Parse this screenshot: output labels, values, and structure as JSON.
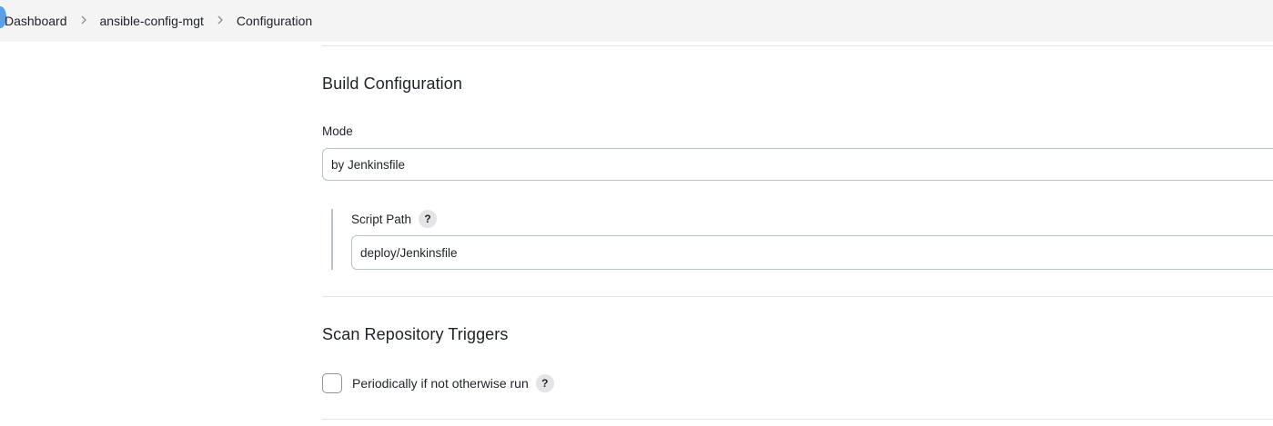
{
  "breadcrumb": {
    "items": [
      "Dashboard",
      "ansible-config-mgt",
      "Configuration"
    ],
    "separator": ">"
  },
  "build_configuration": {
    "title": "Build Configuration",
    "mode_label": "Mode",
    "mode_value": "by Jenkinsfile",
    "script_path_label": "Script Path",
    "script_path_value": "deploy/Jenkinsfile",
    "help_glyph": "?"
  },
  "scan_triggers": {
    "title": "Scan Repository Triggers",
    "periodic_label": "Periodically if not otherwise run",
    "periodic_checked": false,
    "help_glyph": "?"
  },
  "colors": {
    "breadcrumb_bg": "#f4f4f5",
    "input_border": "#b9c4c8",
    "help_bg": "#e4e4e7"
  }
}
